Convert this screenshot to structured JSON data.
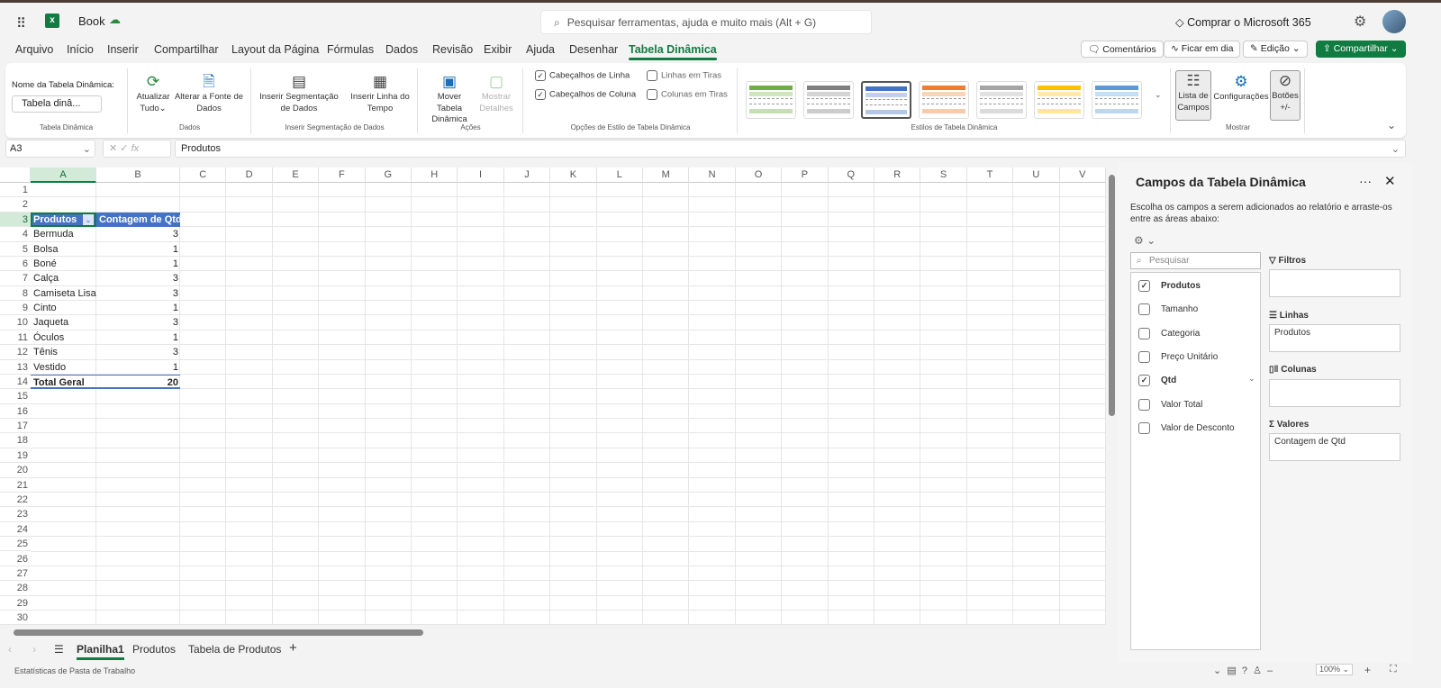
{
  "app": {
    "doc_title": "Book",
    "search_placeholder": "Pesquisar ferramentas, ajuda e muito mais (Alt + G)",
    "buy": "Comprar o Microsoft 365"
  },
  "menu": [
    "Arquivo",
    "Início",
    "Inserir",
    "Compartilhar",
    "Layout da Página",
    "Fórmulas",
    "Dados",
    "Revisão",
    "Exibir",
    "Ajuda",
    "Desenhar",
    "Tabela Dinâmica"
  ],
  "actions": {
    "comments": "Comentários",
    "catchup": "Ficar em dia",
    "editing": "Edição",
    "share": "Compartilhar"
  },
  "ribbon": {
    "pt_name_label": "Nome da Tabela Dinâmica:",
    "pt_name_value": "Tabela dinâ...",
    "g1": "Tabela Dinâmica",
    "refresh": "Atualizar Tudo",
    "change_source": "Alterar a Fonte de Dados",
    "g2": "Dados",
    "insert_slicer": "Inserir Segmentação de Dados",
    "insert_timeline": "Inserir Linha do Tempo",
    "g3": "Inserir Segmentação de Dados",
    "move": "Mover Tabela Dinâmica",
    "show_details": "Mostrar Detalhes",
    "g4": "Ações",
    "row_headers": "Cabeçalhos de Linha",
    "col_headers": "Cabeçalhos de Coluna",
    "banded_rows": "Linhas em Tiras",
    "banded_cols": "Colunas em Tiras",
    "g5": "Opções de Estilo de Tabela Dinâmica",
    "g6": "Estilos de Tabela Dinâmica",
    "style_colors": [
      "#70ad47",
      "#7f7f7f",
      "#4472c4",
      "#ed7d31",
      "#a5a5a5",
      "#ffc000",
      "#5b9bd5"
    ],
    "field_list": "Lista de Campos",
    "settings": "Configurações",
    "buttons": "Botões +/-",
    "g7": "Mostrar"
  },
  "formula": {
    "namebox": "A3",
    "fx": "fx",
    "value": "Produtos"
  },
  "grid": {
    "columns": [
      "A",
      "B",
      "C",
      "D",
      "E",
      "F",
      "G",
      "H",
      "I",
      "J",
      "K",
      "L",
      "M",
      "N",
      "O",
      "P",
      "Q",
      "R",
      "S",
      "T",
      "U",
      "V"
    ],
    "rows": [
      "1",
      "2",
      "3",
      "4",
      "5",
      "6",
      "7",
      "8",
      "9",
      "10",
      "11",
      "12",
      "13",
      "14",
      "15",
      "16",
      "17",
      "18",
      "19",
      "20",
      "21",
      "22",
      "23",
      "24",
      "25",
      "26",
      "27",
      "28",
      "29",
      "30"
    ],
    "pivot_headers": [
      "Produtos",
      "Contagem de Qtd"
    ],
    "pivot_rows": [
      [
        "Bermuda",
        "3"
      ],
      [
        "Bolsa",
        "1"
      ],
      [
        "Boné",
        "1"
      ],
      [
        "Calça",
        "3"
      ],
      [
        "Camiseta Lisa",
        "3"
      ],
      [
        "Cinto",
        "1"
      ],
      [
        "Jaqueta",
        "3"
      ],
      [
        "Óculos",
        "1"
      ],
      [
        "Tênis",
        "3"
      ],
      [
        "Vestido",
        "1"
      ]
    ],
    "total": [
      "Total Geral",
      "20"
    ]
  },
  "sheets": [
    "Planilha1",
    "Produtos",
    "Tabela de Produtos"
  ],
  "status": {
    "left": "Estatísticas de Pasta de Trabalho",
    "zoom": "100%"
  },
  "panel": {
    "title": "Campos da Tabela Dinâmica",
    "desc": "Escolha os campos a serem adicionados ao relatório e arraste-os entre as áreas abaixo:",
    "search_placeholder": "Pesquisar",
    "fields": [
      {
        "name": "Produtos",
        "checked": true
      },
      {
        "name": "Tamanho",
        "checked": false
      },
      {
        "name": "Categoria",
        "checked": false
      },
      {
        "name": "Preço Unitário",
        "checked": false
      },
      {
        "name": "Qtd",
        "checked": true
      },
      {
        "name": "Valor Total",
        "checked": false
      },
      {
        "name": "Valor de Desconto",
        "checked": false
      }
    ],
    "filters": "Filtros",
    "rows_label": "Linhas",
    "rows_value": "Produtos",
    "cols_label": "Colunas",
    "values_label": "Valores",
    "values_value": "Contagem de Qtd"
  }
}
